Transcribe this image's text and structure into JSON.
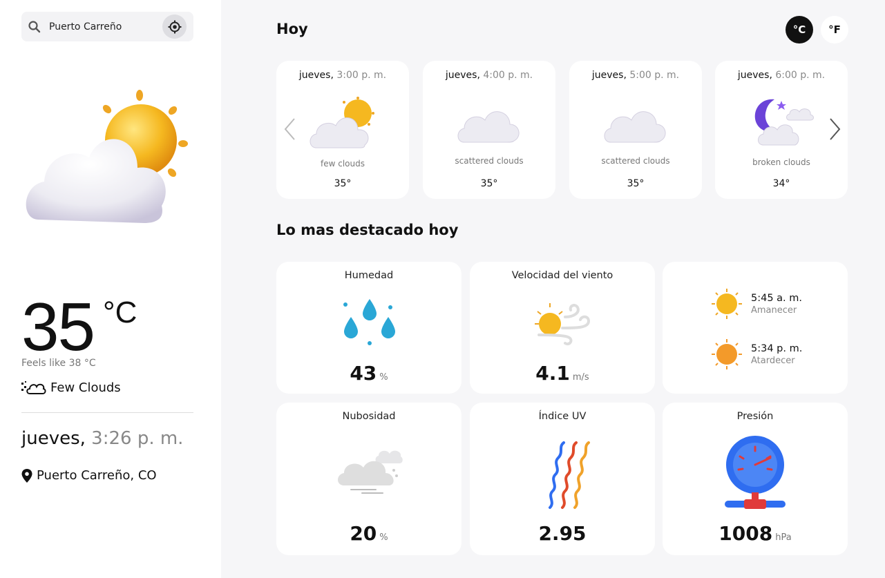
{
  "search": {
    "value": "Puerto Carreño"
  },
  "current": {
    "temp": "35",
    "unit": "°C",
    "feels_like": "Feels like 38 °C",
    "condition": "Few Clouds",
    "day": "jueves,",
    "time": "3:26 p. m.",
    "location": "Puerto Carreño, CO"
  },
  "units": {
    "celsius": "°C",
    "fahrenheit": "°F",
    "selected": "celsius"
  },
  "today": {
    "title": "Hoy",
    "hours": [
      {
        "day": "jueves,",
        "time": "3:00 p. m.",
        "desc": "few clouds",
        "temp": "35°",
        "icon": "few-clouds-icon"
      },
      {
        "day": "jueves,",
        "time": "4:00 p. m.",
        "desc": "scattered clouds",
        "temp": "35°",
        "icon": "scattered-clouds-icon"
      },
      {
        "day": "jueves,",
        "time": "5:00 p. m.",
        "desc": "scattered clouds",
        "temp": "35°",
        "icon": "scattered-clouds-icon"
      },
      {
        "day": "jueves,",
        "time": "6:00 p. m.",
        "desc": "broken clouds",
        "temp": "34°",
        "icon": "night-broken-clouds-icon"
      }
    ]
  },
  "highlights": {
    "title": "Lo mas destacado hoy",
    "humidity": {
      "label": "Humedad",
      "value": "43",
      "unit": "%"
    },
    "wind": {
      "label": "Velocidad del viento",
      "value": "4.1",
      "unit": "m/s"
    },
    "sunrise": {
      "time": "5:45 a. m.",
      "label": "Amanecer"
    },
    "sunset": {
      "time": "5:34 p. m.",
      "label": "Atardecer"
    },
    "clouds": {
      "label": "Nubosidad",
      "value": "20",
      "unit": "%"
    },
    "uv": {
      "label": "Índice UV",
      "value": "2.95"
    },
    "pressure": {
      "label": "Presión",
      "value": "1008",
      "unit": "hPa"
    }
  },
  "colors": {
    "sun": "#f5b820",
    "sunset": "#f39a2a",
    "cloud": "#ecebf2",
    "moon": "#6b43d8",
    "drop": "#2aa7d6",
    "gauge": "#2f6df0"
  }
}
